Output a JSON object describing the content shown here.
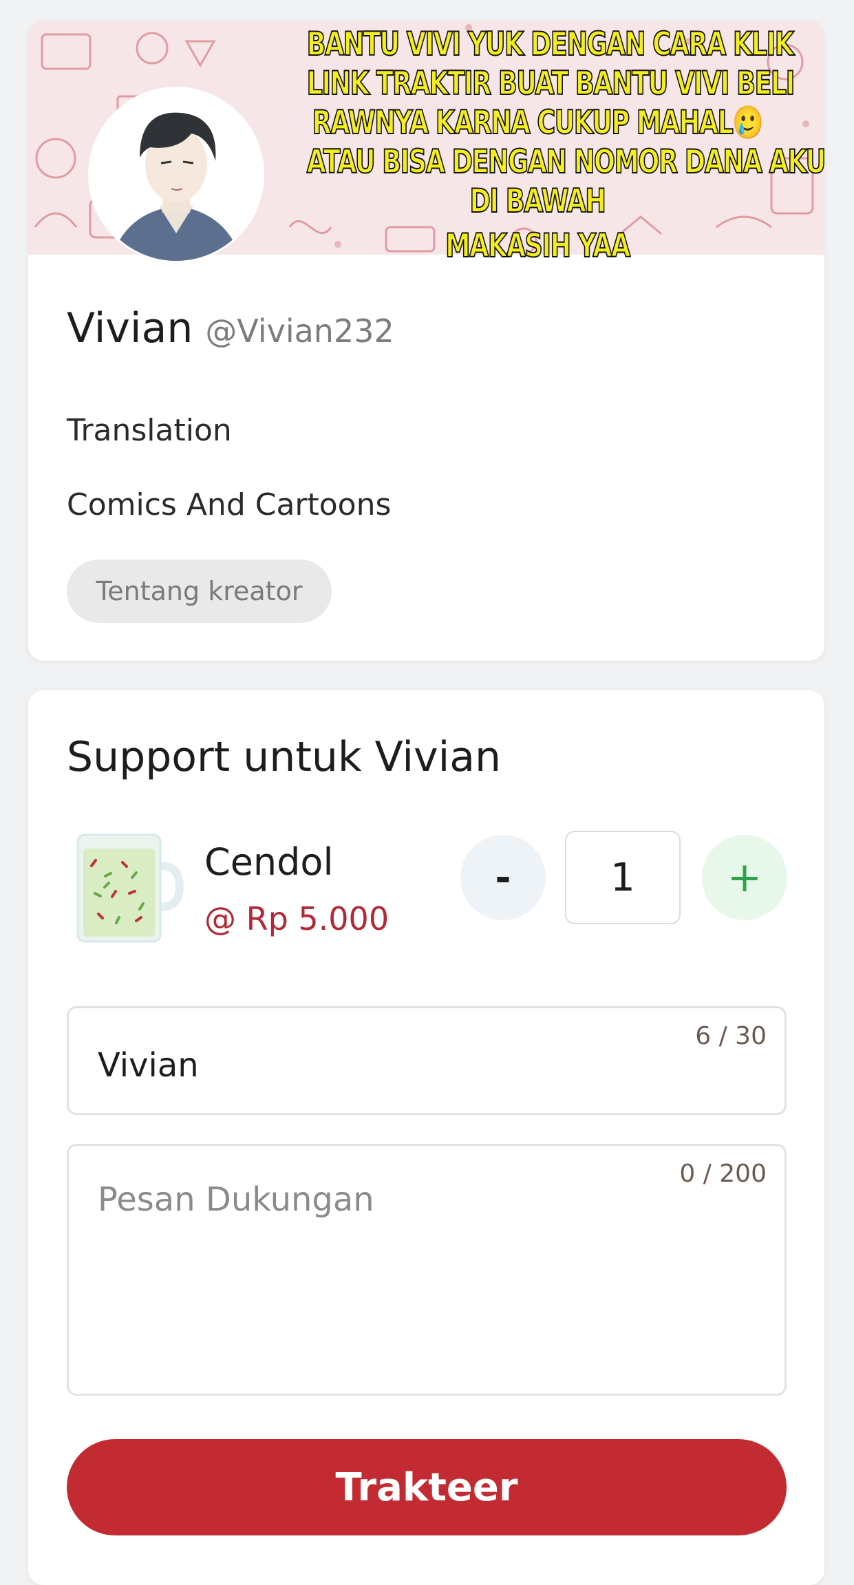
{
  "banner": {
    "lines": [
      "BANTU VIVI YUK DENGAN CARA KLIK",
      "LINK TRAKTIR BUAT BANTU VIVI BELI",
      "RAWNYA  KARNA CUKUP MAHAL🥲",
      "ATAU BISA DENGAN NOMOR DANA AKU",
      "DI BAWAH",
      "MAKASIH YAA"
    ]
  },
  "profile": {
    "name": "Vivian",
    "handle": "@Vivian232",
    "category_1": "Translation",
    "category_2": "Comics And Cartoons",
    "about_button": "Tentang kreator"
  },
  "support": {
    "title": "Support untuk Vivian",
    "item": {
      "name": "Cendol",
      "price": "@ Rp 5.000",
      "icon": "cendol-glass-icon"
    },
    "quantity": {
      "minus_label": "-",
      "value": "1",
      "plus_label": "+"
    },
    "name_field": {
      "value": "Vivian",
      "counter": "6 / 30"
    },
    "message_field": {
      "placeholder": "Pesan Dukungan",
      "counter": "0 / 200"
    },
    "submit_label": "Trakteer"
  },
  "colors": {
    "accent": "#c32b32",
    "price": "#b22836",
    "plus": "#2ea24c",
    "banner_text": "#f5ee1e"
  }
}
